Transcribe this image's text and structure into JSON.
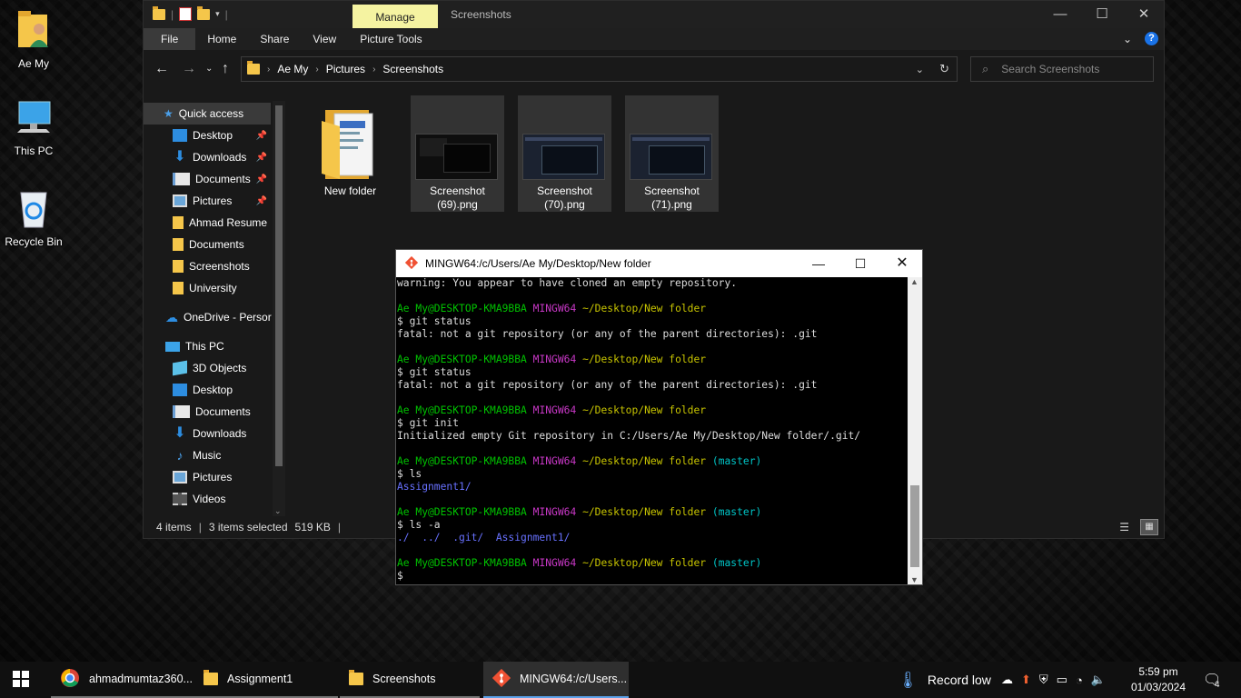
{
  "desktop": {
    "icons": [
      {
        "label": "Ae My",
        "icon": "user-folder-icon"
      },
      {
        "label": "This PC",
        "icon": "computer-icon"
      },
      {
        "label": "Recycle Bin",
        "icon": "recycle-bin-icon"
      }
    ]
  },
  "explorer": {
    "manage_tab": "Manage",
    "window_title": "Screenshots",
    "ribbon_tabs": [
      "File",
      "Home",
      "Share",
      "View",
      "Picture Tools"
    ],
    "breadcrumb": [
      "Ae My",
      "Pictures",
      "Screenshots"
    ],
    "search_placeholder": "Search Screenshots",
    "nav": {
      "quick_access": "Quick access",
      "items": [
        {
          "label": "Desktop",
          "pinned": true
        },
        {
          "label": "Downloads",
          "pinned": true
        },
        {
          "label": "Documents",
          "pinned": true
        },
        {
          "label": "Pictures",
          "pinned": true
        },
        {
          "label": "Ahmad Resume"
        },
        {
          "label": "Documents"
        },
        {
          "label": "Screenshots"
        },
        {
          "label": "University"
        },
        {
          "label": "OneDrive - Persor"
        },
        {
          "label": "This PC"
        },
        {
          "label": "3D Objects"
        },
        {
          "label": "Desktop"
        },
        {
          "label": "Documents"
        },
        {
          "label": "Downloads"
        },
        {
          "label": "Music"
        },
        {
          "label": "Pictures"
        },
        {
          "label": "Videos"
        }
      ]
    },
    "files": [
      {
        "name": "New folder",
        "type": "folder"
      },
      {
        "name": "Screenshot (69).png",
        "line1": "Screenshot",
        "line2": "(69).png"
      },
      {
        "name": "Screenshot (70).png",
        "line1": "Screenshot",
        "line2": "(70).png"
      },
      {
        "name": "Screenshot (71).png",
        "line1": "Screenshot",
        "line2": "(71).png"
      }
    ],
    "status": {
      "count": "4 items",
      "selected": "3 items selected",
      "size": "519 KB"
    }
  },
  "terminal": {
    "title": "MINGW64:/c/Users/Ae My/Desktop/New folder",
    "lines": [
      "warning: You appear to have cloned an empty repository.",
      "",
      "PROMPT",
      "$ git status",
      "fatal: not a git repository (or any of the parent directories): .git",
      "",
      "PROMPT",
      "$ git status",
      "fatal: not a git repository (or any of the parent directories): .git",
      "",
      "PROMPT",
      "$ git init",
      "Initialized empty Git repository in C:/Users/Ae My/Desktop/New folder/.git/",
      "",
      "PROMPT_MASTER",
      "$ ls",
      "LS1",
      "",
      "PROMPT_MASTER",
      "$ ls -a",
      "LSA",
      "",
      "PROMPT_MASTER",
      "$"
    ],
    "prompt_user": "Ae My@DESKTOP-KMA9BBA",
    "prompt_env": "MINGW64",
    "prompt_path": "~/Desktop/New folder",
    "prompt_branch": "(master)",
    "ls_output": "Assignment1/",
    "ls_a_output": "./  ../  .git/  Assignment1/"
  },
  "taskbar": {
    "items": [
      {
        "label": "ahmadmumtaz360...",
        "icon": "chrome-icon"
      },
      {
        "label": "Assignment1",
        "icon": "folder-icon"
      },
      {
        "label": "Screenshots",
        "icon": "folder-icon"
      },
      {
        "label": "MINGW64:/c/Users...",
        "icon": "git-icon"
      }
    ],
    "weather": "Record low",
    "time": "5:59 pm",
    "date": "01/03/2024",
    "notifications": "4"
  }
}
